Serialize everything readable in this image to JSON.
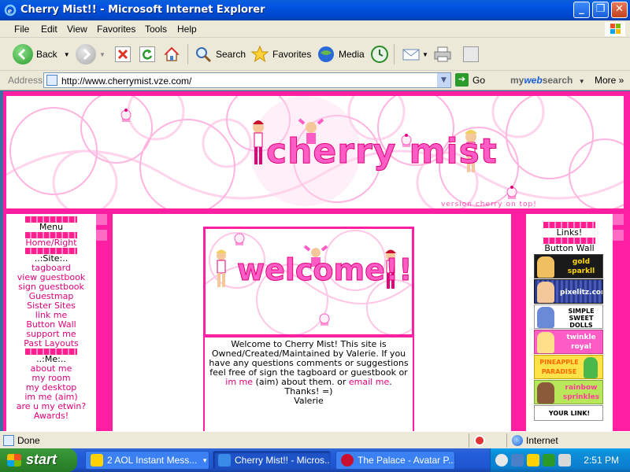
{
  "window": {
    "title": "Cherry Mist!! - Microsoft Internet Explorer",
    "minimize_glyph": "_",
    "maximize_glyph": "❐",
    "close_glyph": "✕"
  },
  "menu": {
    "items": [
      "File",
      "Edit",
      "View",
      "Favorites",
      "Tools",
      "Help"
    ]
  },
  "toolbar": {
    "back_label": "Back",
    "search_label": "Search",
    "favorites_label": "Favorites",
    "media_label": "Media"
  },
  "address": {
    "label": "Address",
    "url": "http://www.cherrymist.vze.com/",
    "go_label": "Go",
    "mywebsearch_prefix": "my",
    "mywebsearch_web": "web",
    "mywebsearch_suffix": "search",
    "more_label": "More »"
  },
  "site": {
    "header_title": "cherry mist",
    "version_text": "version cherry on top!",
    "welcome_banner": "welcome!!",
    "nav": {
      "menu_title": "Menu",
      "home_link": "Home/Right",
      "site_section": "..:Site:..",
      "site_links": [
        "tagboard",
        "view guestbook",
        "sign guestbook",
        "Guestmap",
        "Sister Sites",
        "link me",
        "Button Wall",
        "support me",
        "Past Layouts"
      ],
      "me_section": "..:Me:..",
      "me_links": [
        "about me",
        "my room",
        "my desktop",
        "im me (aim)",
        "are u my etwin?",
        "Awards!"
      ]
    },
    "welcome": {
      "line1": "Welcome to Cherry Mist! This site is Owned/Created/Maintained by Valerie. If you have any questions comments or suggestions feel free of sign the tagboard or guestbook or",
      "im_link": "im me",
      "middle": "(aim) about them. or",
      "email_link": "email me",
      "end": ".",
      "thanks": "Thanks! =)",
      "signature": "Valerie"
    },
    "right": {
      "links_title": "Links!",
      "button_wall_title": "Button Wall",
      "buttons": [
        {
          "text": "gold sparkll",
          "bg": "#1a1a1a",
          "fg": "#ffd700"
        },
        {
          "text": "pixelitz.com",
          "bg": "#2a3a8a",
          "fg": "#ffffff"
        },
        {
          "text": "SIMPLE SWEET DOLLS",
          "bg": "#ffffff",
          "fg": "#000000"
        },
        {
          "text": "twinkle royal",
          "bg": "#ff5cc5",
          "fg": "#ffffff"
        },
        {
          "text": "PINEAPPLE PARADISE",
          "bg": "#ffe14a",
          "fg": "#ff6a00"
        },
        {
          "text": "rainbow sprinkles",
          "bg": "#b8e85a",
          "fg": "#ff3a9a"
        },
        {
          "text": "YOUR LINK!",
          "bg": "#ffffff",
          "fg": "#000000"
        }
      ]
    }
  },
  "status": {
    "text": "Done",
    "zone": "Internet"
  },
  "taskbar": {
    "start_label": "start",
    "tasks": [
      "2 AOL Instant Mess...",
      "Cherry Mist!! - Micros...",
      "The Palace - Avatar P..."
    ],
    "clock": "2:51 PM"
  },
  "colors": {
    "accent_pink": "#ff1fa3",
    "link_pink": "#e0007a",
    "xp_blue": "#0054e3",
    "xp_gray": "#ece9d8"
  }
}
